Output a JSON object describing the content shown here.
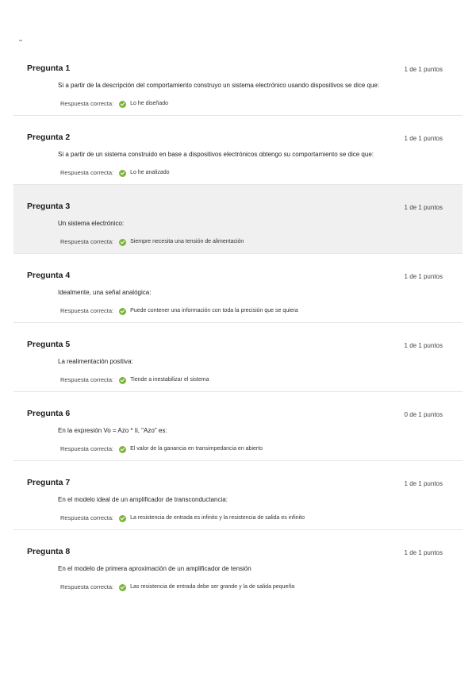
{
  "questions": [
    {
      "title": "Pregunta 1",
      "points": "1 de 1 puntos",
      "text": "Si a partir de la descripción del comportamiento construyo un sistema electrónico usando dispositivos se dice que:",
      "answer_label": "Respuesta correcta:",
      "answer": "Lo he diseñado"
    },
    {
      "title": "Pregunta 2",
      "points": "1 de 1 puntos",
      "text": "Si a partir de un sistema construido en base a dispositivos electrónicos obtengo su comportamiento se dice que:",
      "answer_label": "Respuesta correcta:",
      "answer": "Lo he analizado"
    },
    {
      "title": "Pregunta 3",
      "points": "1 de 1 puntos",
      "text": "Un sistema electrónico:",
      "answer_label": "Respuesta correcta:",
      "answer": "Siempre necesita una tensión de alimentación"
    },
    {
      "title": "Pregunta 4",
      "points": "1 de 1 puntos",
      "text": "Idealmente, una señal analógica:",
      "answer_label": "Respuesta correcta:",
      "answer": "Puede contener una información con toda la precisión que se quiera"
    },
    {
      "title": "Pregunta 5",
      "points": "1 de 1 puntos",
      "text": "La realimentación positiva:",
      "answer_label": "Respuesta correcta:",
      "answer": "Tiende a inestabilizar el sistema"
    },
    {
      "title": "Pregunta 6",
      "points": "0 de 1 puntos",
      "text": "En la expresión Vo = Azo * Ii, \"Azo\" es:",
      "answer_label": "Respuesta correcta:",
      "answer": "El valor de la ganancia en transimpedancia en abierto"
    },
    {
      "title": "Pregunta 7",
      "points": "1 de 1 puntos",
      "text": "En el modelo ideal de un amplificador de transconductancia:",
      "answer_label": "Respuesta correcta:",
      "answer": "La resistencia de entrada es infinito y la resistencia de salida es infinito"
    },
    {
      "title": "Pregunta 8",
      "points": "1 de 1 puntos",
      "text": "En el modelo de primera aproximación de un amplificador de tensión",
      "answer_label": "Respuesta correcta:",
      "answer": "Las resistencia de entrada debe ser grande y la de salida pequeña"
    }
  ],
  "colors": {
    "check_green": "#7db53a",
    "highlight_row": "#f0f0f0",
    "divider": "#e6e6e6"
  },
  "icons": {
    "answer_status": "check-icon"
  }
}
